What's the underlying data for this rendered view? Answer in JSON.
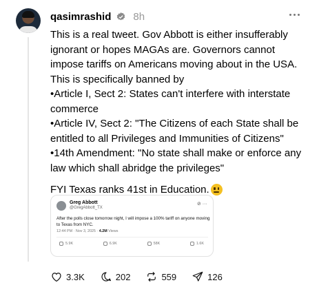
{
  "post": {
    "username": "qasimrashid",
    "time": "8h",
    "body": [
      "This is a real tweet. Gov Abbott is either insufferably ignorant or hopes MAGAs are. Governors cannot impose tariffs on Americans moving about in the USA. This is specifically banned by",
      "•Article I, Sect 2: States can't interfere with interstate commerce",
      "•Article IV, Sect 2: \"The Citizens of each State shall be entitled to all Privileges and Immunities of Citizens\"",
      "•14th Amendment: \"No state shall make or enforce any law which shall abridge the privileges\""
    ],
    "fyi": "FYI Texas ranks 41st in Education.",
    "emoji": "neutral-face-emoji"
  },
  "embedded": {
    "name": "Greg Abbott",
    "handle": "@GregAbbott_TX",
    "text": "After the polls close tomorrow night, I will impose a 100% tariff on anyone moving to Texas from NYC.",
    "meta_time": "12:44 PM · Nov 3, 2025 ·",
    "meta_views": "4.2M",
    "meta_views_label": "Views",
    "stats": [
      "5.9K",
      "6.9K",
      "58K",
      "1.6K"
    ]
  },
  "actions": {
    "likes": "3.3K",
    "replies": "202",
    "reposts": "559",
    "shares": "126"
  },
  "colors": {
    "verified": "#8a8a8a",
    "muted": "#999999",
    "emoji": "#f4c022"
  }
}
